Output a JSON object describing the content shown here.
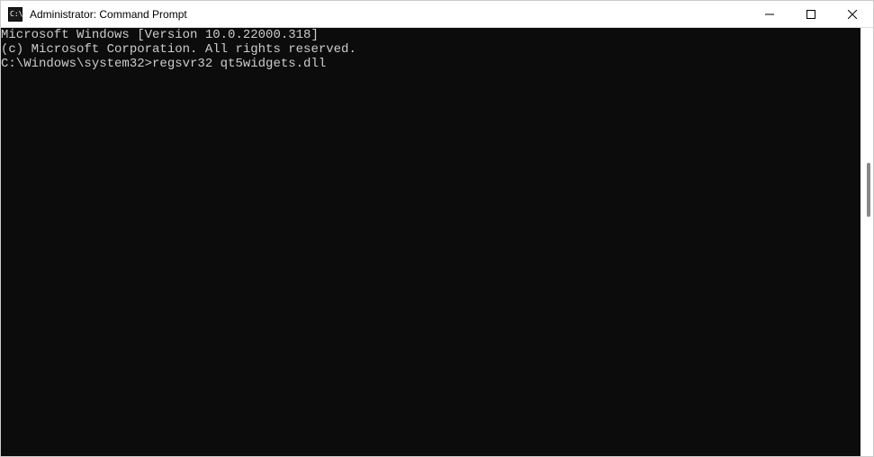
{
  "window": {
    "title": "Administrator: Command Prompt"
  },
  "terminal": {
    "lines": [
      "Microsoft Windows [Version 10.0.22000.318]",
      "(c) Microsoft Corporation. All rights reserved.",
      "",
      "C:\\Windows\\system32>regsvr32 qt5widgets.dll"
    ],
    "prompt": "C:\\Windows\\system32>",
    "command": "regsvr32 qt5widgets.dll"
  }
}
